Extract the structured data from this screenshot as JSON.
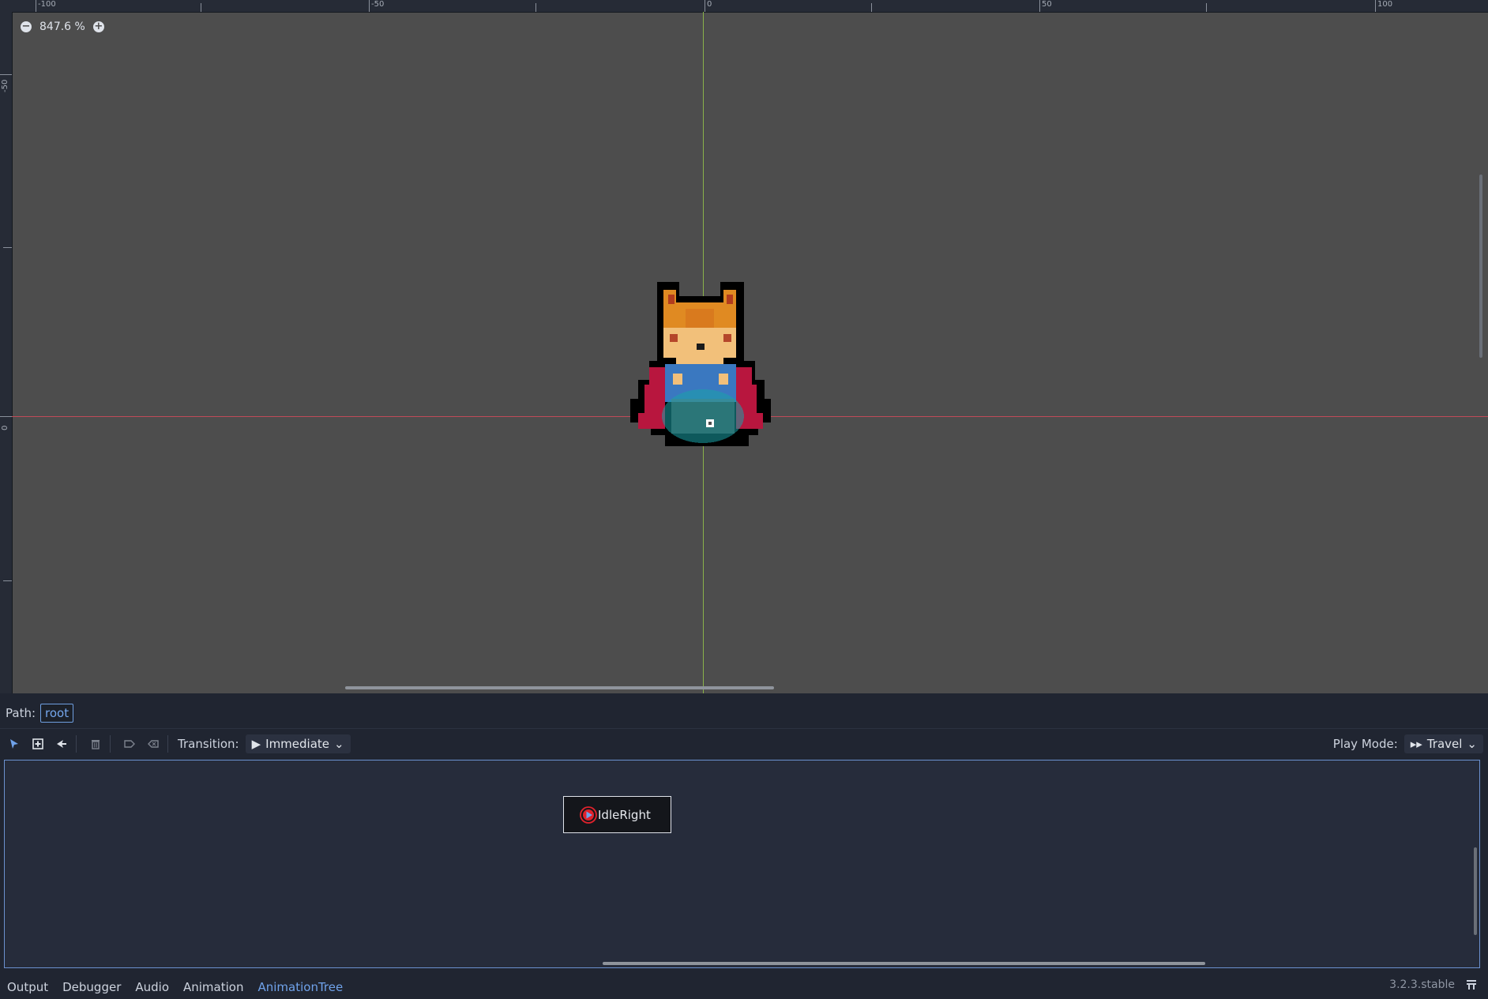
{
  "viewport": {
    "zoom_label": "847.6 %",
    "ruler_top_labels": [
      "-100",
      "-50",
      "0",
      "50",
      "100"
    ],
    "ruler_left_labels": [
      "-50",
      "0"
    ]
  },
  "path": {
    "label": "Path:",
    "value": "root"
  },
  "toolbar": {
    "transition_label": "Transition:",
    "transition_value": "Immediate",
    "play_mode_label": "Play Mode:",
    "play_mode_value": "Travel"
  },
  "graph": {
    "nodes": [
      {
        "label": "IdleRight"
      }
    ]
  },
  "bottom_tabs": [
    "Output",
    "Debugger",
    "Audio",
    "Animation",
    "AnimationTree"
  ],
  "active_tab": "AnimationTree",
  "version": "3.2.3.stable",
  "colors": {
    "accent": "#6fa2ea",
    "x_axis": "#c04a58",
    "y_axis": "#8ab34a",
    "node_border": "#dfe3ea"
  }
}
